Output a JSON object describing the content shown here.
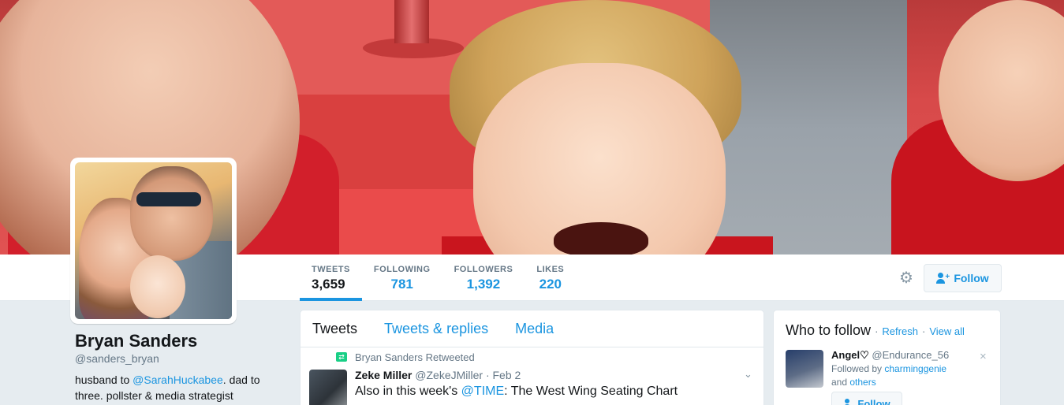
{
  "profile": {
    "name": "Bryan Sanders",
    "handle": "@sanders_bryan",
    "bio_prefix": "husband to ",
    "bio_mention": "@SarahHuckabee",
    "bio_suffix": ". dad to three. pollster & media strategist"
  },
  "stats": [
    {
      "label": "TWEETS",
      "value": "3,659"
    },
    {
      "label": "FOLLOWING",
      "value": "781"
    },
    {
      "label": "FOLLOWERS",
      "value": "1,392"
    },
    {
      "label": "LIKES",
      "value": "220"
    }
  ],
  "actions": {
    "follow_label": "Follow",
    "settings_icon": "gear-icon"
  },
  "timeline": {
    "tabs": [
      "Tweets",
      "Tweets & replies",
      "Media"
    ],
    "tweet": {
      "retweet_text": "Bryan Sanders Retweeted",
      "author_name": "Zeke Miller",
      "author_handle": "@ZekeJMiller",
      "separator": "·",
      "date": "Feb 2",
      "text_prefix": "Also in this week's ",
      "text_mention": "@TIME",
      "text_suffix": ": The West Wing Seating Chart"
    }
  },
  "who_to_follow": {
    "title": "Who to follow",
    "separator": "·",
    "refresh": "Refresh",
    "view_all": "View all",
    "suggestion": {
      "name": "Angel♡",
      "handle": "@Endurance_56",
      "followed_by_prefix": "Followed by ",
      "followed_by_user": "charminggenie",
      "and_text": "and ",
      "others": "others",
      "follow_label": "Follow",
      "dismiss": "×"
    }
  },
  "colors": {
    "accent": "#1b95e0",
    "background": "#e6ecf0",
    "retweet_green": "#19cf86"
  }
}
